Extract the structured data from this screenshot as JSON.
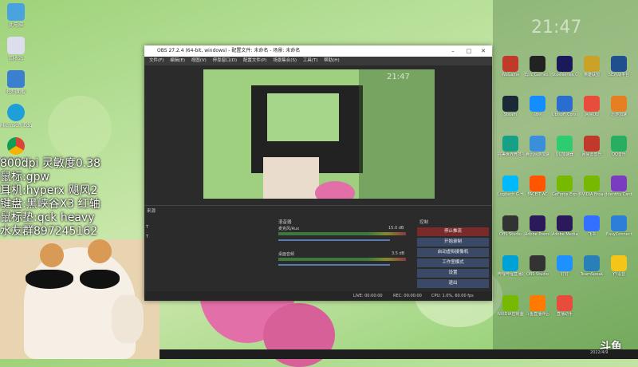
{
  "overlay": {
    "line1": "800dpi 灵敏度0.38",
    "line2": "鼠标:gpw",
    "line3": "耳机:hyperx 飓风2",
    "line4": "键盘:黑峡谷X3 红轴",
    "line5": "鼠标垫:qck heavy",
    "line6": "水友群897245162"
  },
  "desktop_left": [
    {
      "label": "此电脑"
    },
    {
      "label": "回收站"
    },
    {
      "label": "控制面板"
    },
    {
      "label": "Microsoft Edge"
    },
    {
      "label": "Google Chrome"
    }
  ],
  "clock": "21:47",
  "obs": {
    "title": "OBS 27.2.4 (64-bit, windows) - 配置文件: 未命名 - 场景: 未命名",
    "menu": [
      "文件(F)",
      "编辑(E)",
      "视图(V)",
      "停靠窗口(D)",
      "配置文件(P)",
      "场景集合(S)",
      "工具(T)",
      "帮助(H)"
    ],
    "preview_clock": "21:47",
    "docks": {
      "sources": "来源",
      "mixer": "混音器",
      "controls": "控制"
    },
    "mixer": {
      "track1_name": "麦克风/Aux",
      "track1_db": "15.0 dB",
      "track2_name": "桌面音频",
      "track2_db": "3.5 dB"
    },
    "controls": [
      "停止推流",
      "开始录制",
      "启动虚拟摄像机",
      "工作室模式",
      "设置",
      "退出"
    ],
    "status": {
      "live": "LIVE: 00:00:00",
      "rec": "REC: 00:00:00",
      "cpu": "CPU: 1.0%, 60.00 fps"
    }
  },
  "right_icons": [
    {
      "label": "WeGame"
    },
    {
      "label": "Epic Games Launcher"
    },
    {
      "label": "Steelseries GG"
    },
    {
      "label": "英雄联盟"
    },
    {
      "label": "5E对战平台"
    },
    {
      "label": "Steam"
    },
    {
      "label": "战网"
    },
    {
      "label": "Ubisoft Connect"
    },
    {
      "label": "网易UU"
    },
    {
      "label": "迅游加速"
    },
    {
      "label": "完美世界竞技平台"
    },
    {
      "label": "腾讯网游加速"
    },
    {
      "label": "UU加速器"
    },
    {
      "label": "网易云音乐"
    },
    {
      "label": "QQ音乐"
    },
    {
      "label": "Logitech G HUB"
    },
    {
      "label": "FACEIT AC"
    },
    {
      "label": "GeForce Experience"
    },
    {
      "label": "NVIDIA Broadcast"
    },
    {
      "label": "Identity Card"
    },
    {
      "label": "OBS Studio"
    },
    {
      "label": "Adobe Premiere Pro"
    },
    {
      "label": "Adobe Media Encoder"
    },
    {
      "label": "飞书"
    },
    {
      "label": "EasyConnect"
    },
    {
      "label": "哔哩哔哩直播姬"
    },
    {
      "label": "OBS Studio"
    },
    {
      "label": "钉钉"
    },
    {
      "label": "TeamSpeak"
    },
    {
      "label": "YY语音"
    },
    {
      "label": "NVIDIA控制面板"
    },
    {
      "label": "斗鱼直播伴侣"
    },
    {
      "label": "直播助手"
    }
  ],
  "brand": "斗鱼",
  "taskbar": {
    "time": "2022/4/9"
  }
}
